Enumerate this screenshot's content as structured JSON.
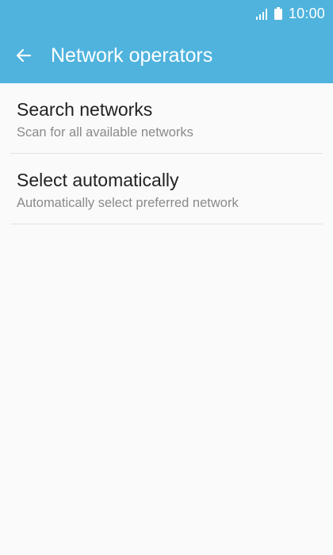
{
  "status_bar": {
    "time": "10:00",
    "icons": [
      "signal-icon",
      "battery-icon"
    ]
  },
  "app_bar": {
    "back_icon": "arrow-left-icon",
    "title": "Network operators"
  },
  "list": {
    "items": [
      {
        "title": "Search networks",
        "subtitle": "Scan for all available networks"
      },
      {
        "title": "Select automatically",
        "subtitle": "Automatically select preferred network"
      }
    ]
  },
  "colors": {
    "header_background": "#4fb3dd",
    "page_background": "#fafafa",
    "primary_text": "#222222",
    "secondary_text": "#8a8a8a"
  }
}
